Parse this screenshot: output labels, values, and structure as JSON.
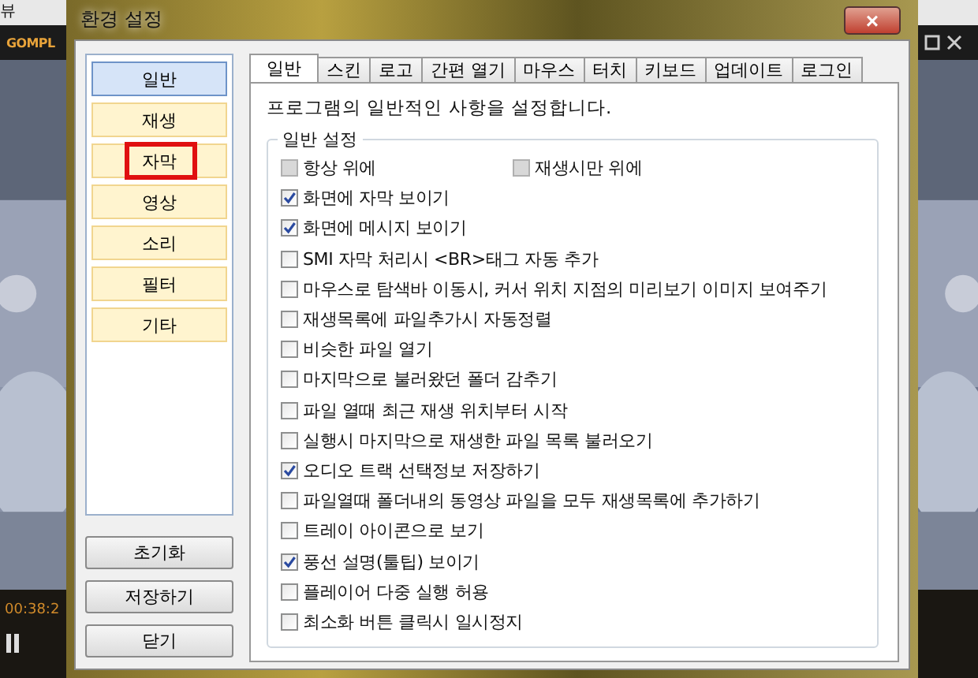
{
  "player": {
    "menu_label": "뷰",
    "logo": "GOMPL",
    "time": "00:38:2"
  },
  "window": {
    "title": "환경 설정",
    "close": "×"
  },
  "categories": [
    {
      "label": "일반",
      "selected": true,
      "highlighted": false
    },
    {
      "label": "재생",
      "selected": false,
      "highlighted": false
    },
    {
      "label": "자막",
      "selected": false,
      "highlighted": true
    },
    {
      "label": "영상",
      "selected": false,
      "highlighted": false
    },
    {
      "label": "소리",
      "selected": false,
      "highlighted": false
    },
    {
      "label": "필터",
      "selected": false,
      "highlighted": false
    },
    {
      "label": "기타",
      "selected": false,
      "highlighted": false
    }
  ],
  "buttons": [
    "초기화",
    "저장하기",
    "닫기"
  ],
  "tabs": [
    {
      "label": "일반",
      "selected": true
    },
    {
      "label": "스킨",
      "selected": false
    },
    {
      "label": "로고",
      "selected": false
    },
    {
      "label": "간편 열기",
      "selected": false
    },
    {
      "label": "마우스",
      "selected": false
    },
    {
      "label": "터치",
      "selected": false
    },
    {
      "label": "키보드",
      "selected": false
    },
    {
      "label": "업데이트",
      "selected": false
    },
    {
      "label": "로그인",
      "selected": false
    }
  ],
  "description": "프로그램의 일반적인 사항을 설정합니다.",
  "group": {
    "title": "일반 설정",
    "rows": [
      [
        {
          "label": "항상 위에",
          "checked": false,
          "disabled": true
        },
        {
          "label": "재생시만 위에",
          "checked": false,
          "disabled": true
        }
      ],
      [
        {
          "label": "화면에 자막 보이기",
          "checked": true,
          "disabled": false
        }
      ],
      [
        {
          "label": "화면에 메시지 보이기",
          "checked": true,
          "disabled": false
        }
      ],
      [
        {
          "label": "SMI 자막 처리시 <BR>태그 자동 추가",
          "checked": false,
          "disabled": false
        }
      ],
      [
        {
          "label": "마우스로 탐색바 이동시, 커서 위치 지점의 미리보기 이미지 보여주기",
          "checked": false,
          "disabled": false
        }
      ],
      [
        {
          "label": "재생목록에 파일추가시 자동정렬",
          "checked": false,
          "disabled": false
        }
      ],
      [
        {
          "label": "비슷한 파일 열기",
          "checked": false,
          "disabled": false
        }
      ],
      [
        {
          "label": "마지막으로 불러왔던 폴더 감추기",
          "checked": false,
          "disabled": false
        }
      ],
      [
        {
          "label": "파일 열때 최근 재생 위치부터 시작",
          "checked": false,
          "disabled": false
        }
      ],
      [
        {
          "label": "실행시 마지막으로 재생한 파일 목록 불러오기",
          "checked": false,
          "disabled": false
        }
      ],
      [
        {
          "label": "오디오 트랙 선택정보 저장하기",
          "checked": true,
          "disabled": false
        }
      ],
      [
        {
          "label": "파일열때 폴더내의 동영상 파일을 모두 재생목록에 추가하기",
          "checked": false,
          "disabled": false
        }
      ],
      [
        {
          "label": "트레이 아이콘으로 보기",
          "checked": false,
          "disabled": false
        }
      ],
      [
        {
          "label": "풍선 설명(툴팁) 보이기",
          "checked": true,
          "disabled": false
        }
      ],
      [
        {
          "label": "플레이어 다중 실행 허용",
          "checked": false,
          "disabled": false
        }
      ],
      [
        {
          "label": "최소화 버튼 클릭시 일시정지",
          "checked": false,
          "disabled": false
        }
      ]
    ]
  }
}
